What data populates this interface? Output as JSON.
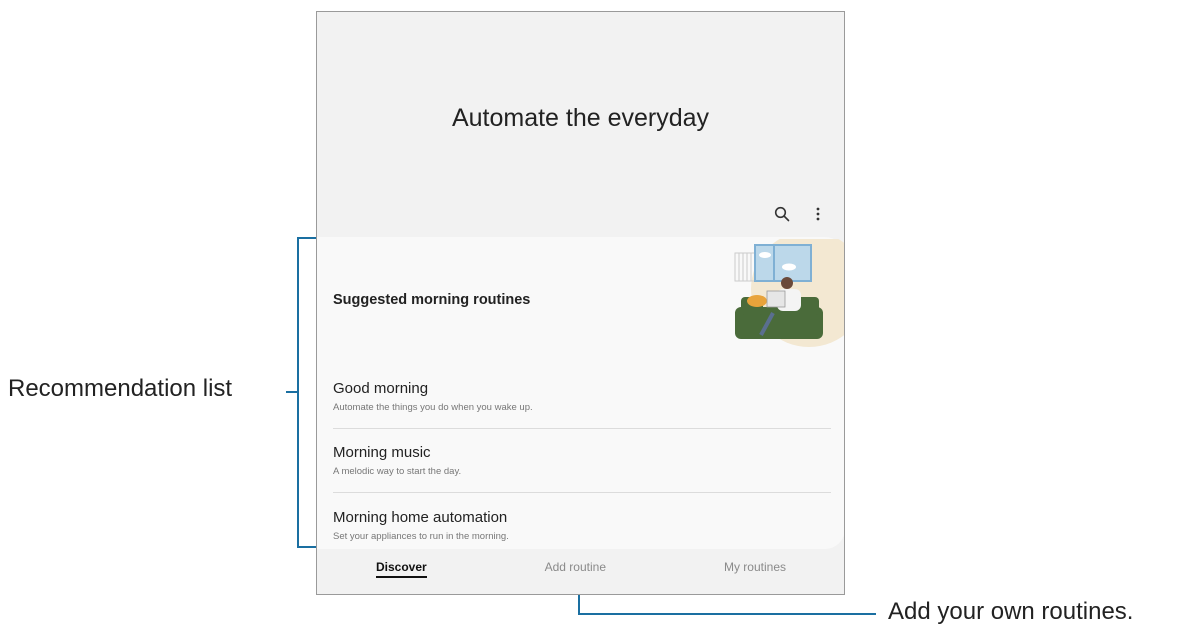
{
  "screen": {
    "title": "Automate the everyday",
    "icons": {
      "search": "search-icon",
      "more": "more-vertical-icon"
    }
  },
  "recommendations": {
    "header": "Suggested morning routines",
    "items": [
      {
        "title": "Good morning",
        "subtitle": "Automate the things you do when you wake up."
      },
      {
        "title": "Morning music",
        "subtitle": "A melodic way to start the day."
      },
      {
        "title": "Morning home automation",
        "subtitle": "Set your appliances to run in the morning."
      }
    ]
  },
  "bottom_nav": {
    "tabs": [
      {
        "label": "Discover",
        "active": true
      },
      {
        "label": "Add routine",
        "active": false
      },
      {
        "label": "My routines",
        "active": false
      }
    ]
  },
  "callouts": {
    "recommendation_list": "Recommendation list",
    "add_routine": "Add your own routines."
  },
  "colors": {
    "callout_line": "#1a6fa1",
    "screen_bg": "#f2f2f2",
    "card_bg": "#f9f9f9"
  }
}
